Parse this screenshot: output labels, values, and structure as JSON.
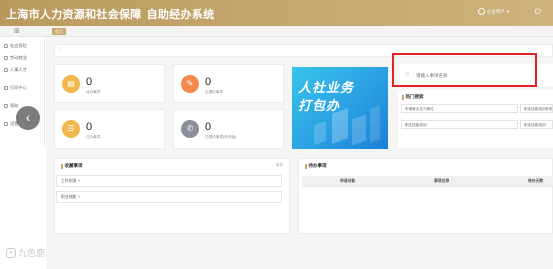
{
  "header": {
    "title": "上海市人力资源和社会保障",
    "subtitle": "自助经办系统",
    "user_label": "企业用户"
  },
  "tabbar": {
    "active_tab": "首页"
  },
  "sidebar": {
    "items": [
      {
        "label": "社会保险"
      },
      {
        "label": "劳动就业"
      },
      {
        "label": "人事人才"
      },
      {
        "label": "打印中心"
      },
      {
        "label": "帮助"
      },
      {
        "label": "设置"
      }
    ]
  },
  "stats": {
    "cards": [
      {
        "value": "0",
        "label": "待办事项",
        "color": "#f0b84c"
      },
      {
        "value": "0",
        "label": "办理中事项",
        "color": "#f28a4c"
      },
      {
        "value": "0",
        "label": "已办事项",
        "color": "#f0b84c"
      },
      {
        "value": "0",
        "label": "已预约事项(未开始)",
        "color": "#8a8f9a"
      }
    ]
  },
  "banner": {
    "line1": "人社业务",
    "line2": "打包办"
  },
  "search": {
    "placeholder": "请输入事项名称"
  },
  "hot": {
    "title": "热门搜索",
    "items": [
      {
        "label": "申请就业见习单位"
      },
      {
        "label": "职业技能培训补贴"
      },
      {
        "label": "职业技能培训"
      },
      {
        "label": "职业技能培训"
      }
    ]
  },
  "favorites": {
    "title": "收藏事项",
    "more": "更多",
    "rows": [
      {
        "label": "工作年限"
      },
      {
        "label": "职业技能"
      }
    ]
  },
  "todo": {
    "title": "待办事项",
    "columns": [
      "申请对象",
      "事项名称",
      "待办天数"
    ]
  },
  "watermark": {
    "text": "九色鹿"
  },
  "colors": {
    "header_gold": "#c3a66c",
    "accent": "#c6a86b",
    "highlight_red": "#e42222",
    "banner_blue": "#2aa0e3"
  }
}
